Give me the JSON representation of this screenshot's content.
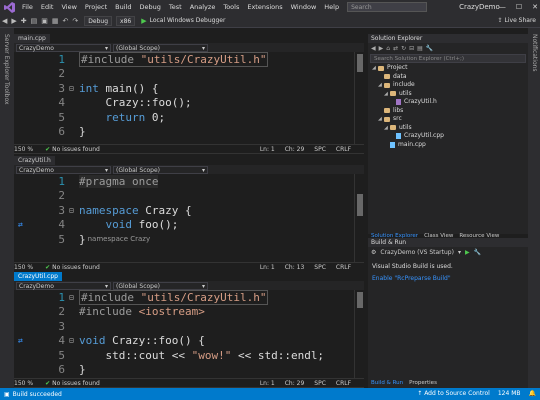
{
  "menubar": {
    "items": [
      "File",
      "Edit",
      "View",
      "Project",
      "Build",
      "Debug",
      "Test",
      "Analyze",
      "Tools",
      "Extensions",
      "Window",
      "Help"
    ],
    "search_placeholder": "Search",
    "window_title": "CrazyDemo"
  },
  "toolbar": {
    "config": "Debug",
    "platform": "x86",
    "run_label": "Local Windows Debugger",
    "live_share": "Live Share"
  },
  "leftbar": {
    "server_explorer": "Server Explorer",
    "toolbox": "Toolbox"
  },
  "rightbar": {
    "notifications": "Notifications"
  },
  "editors": [
    {
      "tab": "main.cpp",
      "nav_project": "CrazyDemo",
      "nav_scope": "(Global Scope)",
      "status": {
        "zoom": "150 %",
        "issues": "No issues found",
        "ln": "Ln: 1",
        "ch": "Ch: 29",
        "spc": "SPC",
        "eol": "CRLF"
      }
    },
    {
      "tab": "CrazyUtil.h",
      "nav_project": "CrazyDemo",
      "nav_scope": "(Global Scope)",
      "status": {
        "zoom": "150 %",
        "issues": "No issues found",
        "ln": "Ln: 1",
        "ch": "Ch: 13",
        "spc": "SPC",
        "eol": "CRLF"
      }
    },
    {
      "tab": "CrazyUtil.cpp",
      "nav_project": "CrazyDemo",
      "nav_scope": "(Global Scope)",
      "status": {
        "zoom": "150 %",
        "issues": "No issues found",
        "ln": "Ln: 1",
        "ch": "Ch: 29",
        "spc": "SPC",
        "eol": "CRLF"
      }
    }
  ],
  "code": {
    "main": [
      {
        "n": "1",
        "t": "#include \"utils/CrazyUtil.h\""
      },
      {
        "n": "2",
        "t": ""
      },
      {
        "n": "3",
        "t": "int main() {"
      },
      {
        "n": "4",
        "t": "    Crazy::foo();"
      },
      {
        "n": "5",
        "t": "    return 0;"
      },
      {
        "n": "6",
        "t": "}"
      }
    ],
    "header": [
      {
        "n": "1",
        "t": "#pragma once"
      },
      {
        "n": "2",
        "t": ""
      },
      {
        "n": "3",
        "t": "namespace Crazy {"
      },
      {
        "n": "4",
        "t": "    void foo();"
      },
      {
        "n": "5",
        "t": "}"
      },
      {
        "n": "",
        "t": "namespace Crazy"
      }
    ],
    "cpp": [
      {
        "n": "1",
        "t": "#include \"utils/CrazyUtil.h\""
      },
      {
        "n": "2",
        "t": "#include <iostream>"
      },
      {
        "n": "3",
        "t": ""
      },
      {
        "n": "4",
        "t": "void Crazy::foo() {"
      },
      {
        "n": "5",
        "t": "    std::cout << \"wow!\" << std::endl;"
      },
      {
        "n": "6",
        "t": "}"
      }
    ]
  },
  "solution_explorer": {
    "title": "Solution Explorer",
    "search_placeholder": "Search Solution Explorer (Ctrl+;)",
    "tree": [
      "Project",
      "data",
      "include",
      "utils",
      "CrazyUtil.h",
      "libs",
      "src",
      "utils",
      "CrazyUtil.cpp",
      "main.cpp"
    ],
    "tabs": [
      "Solution Explorer",
      "Class View",
      "Resource View"
    ]
  },
  "build_run": {
    "title": "Build & Run",
    "target": "CrazyDemo (VS Startup)",
    "message": "Visual Studio Build is used.",
    "link": "Enable \"RcPreparse Build\"",
    "tabs": [
      "Build & Run",
      "Properties"
    ]
  },
  "statusbar": {
    "left": "Build succeeded",
    "source_control": "Add to Source Control",
    "memory": "124 MB"
  }
}
